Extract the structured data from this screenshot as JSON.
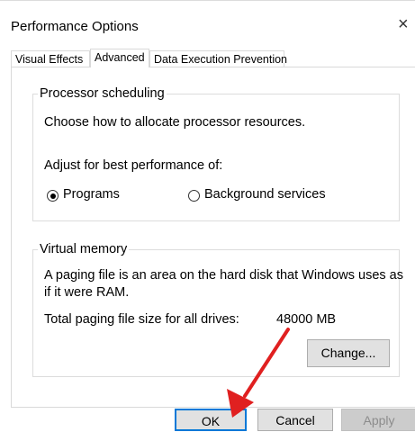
{
  "window": {
    "title": "Performance Options",
    "close_glyph": "×"
  },
  "tabs": [
    {
      "label": "Visual Effects",
      "active": false
    },
    {
      "label": "Advanced",
      "active": true
    },
    {
      "label": "Data Execution Prevention",
      "active": false
    }
  ],
  "processor_scheduling": {
    "legend": "Processor scheduling",
    "description": "Choose how to allocate processor resources.",
    "adjust_label": "Adjust for best performance of:",
    "options": [
      {
        "label": "Programs",
        "selected": true
      },
      {
        "label": "Background services",
        "selected": false
      }
    ]
  },
  "virtual_memory": {
    "legend": "Virtual memory",
    "description_line1": "A paging file is an area on the hard disk that Windows uses as",
    "description_line2": "if it were RAM.",
    "total_label": "Total paging file size for all drives:",
    "total_value": "48000 MB",
    "change_button": "Change..."
  },
  "footer": {
    "ok": "OK",
    "cancel": "Cancel",
    "apply": "Apply"
  },
  "annotation": {
    "arrow_color": "#e02020"
  }
}
